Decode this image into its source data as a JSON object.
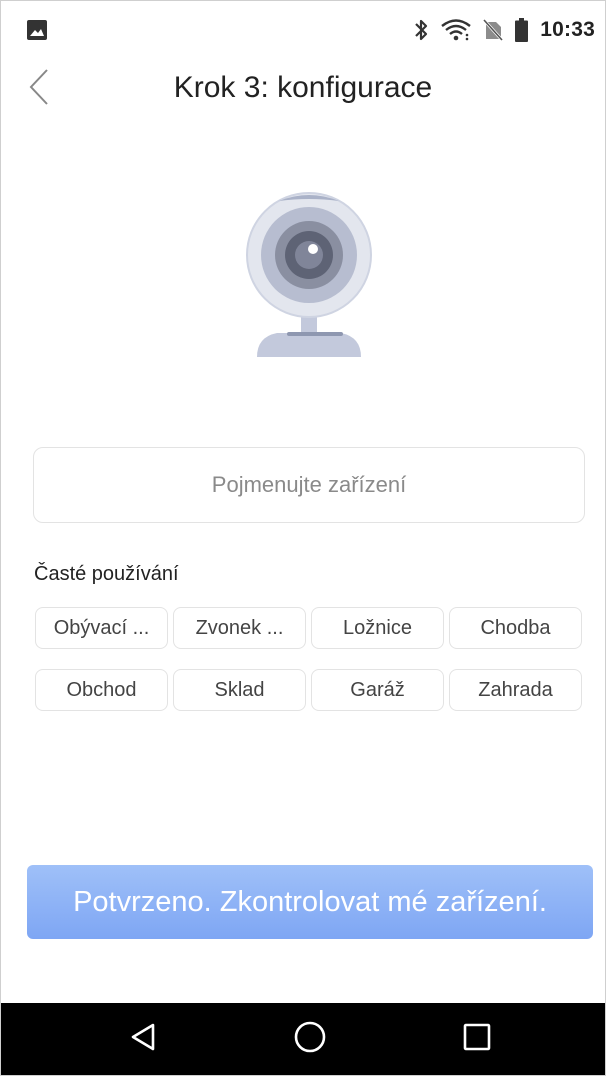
{
  "status_bar": {
    "time": "10:33",
    "left_icon": "image-notification-icon",
    "icons": [
      "bluetooth-icon",
      "wifi-icon",
      "no-sim-icon",
      "battery-icon"
    ]
  },
  "header": {
    "back_icon": "chevron-left-icon",
    "title": "Krok 3: konfigurace"
  },
  "illustration": "webcam-icon",
  "name_input": {
    "placeholder": "Pojmenujte zařízení",
    "value": ""
  },
  "common_use": {
    "label": "Časté používání",
    "chips": [
      "Obývací ...",
      "Zvonek ...",
      "Ložnice",
      "Chodba",
      "Obchod",
      "Sklad",
      "Garáž",
      "Zahrada"
    ]
  },
  "confirm_button": {
    "label": "Potvrzeno. Zkontrolovat mé zařízení."
  },
  "nav_bar": {
    "back_icon": "triangle-back-icon",
    "home_icon": "circle-home-icon",
    "recents_icon": "square-recents-icon"
  },
  "colors": {
    "accent_button": "#8ab0f6",
    "title_text": "#222222",
    "placeholder_text": "#8a8a8a",
    "border": "#e3e3e3",
    "nav_background": "#000000"
  }
}
